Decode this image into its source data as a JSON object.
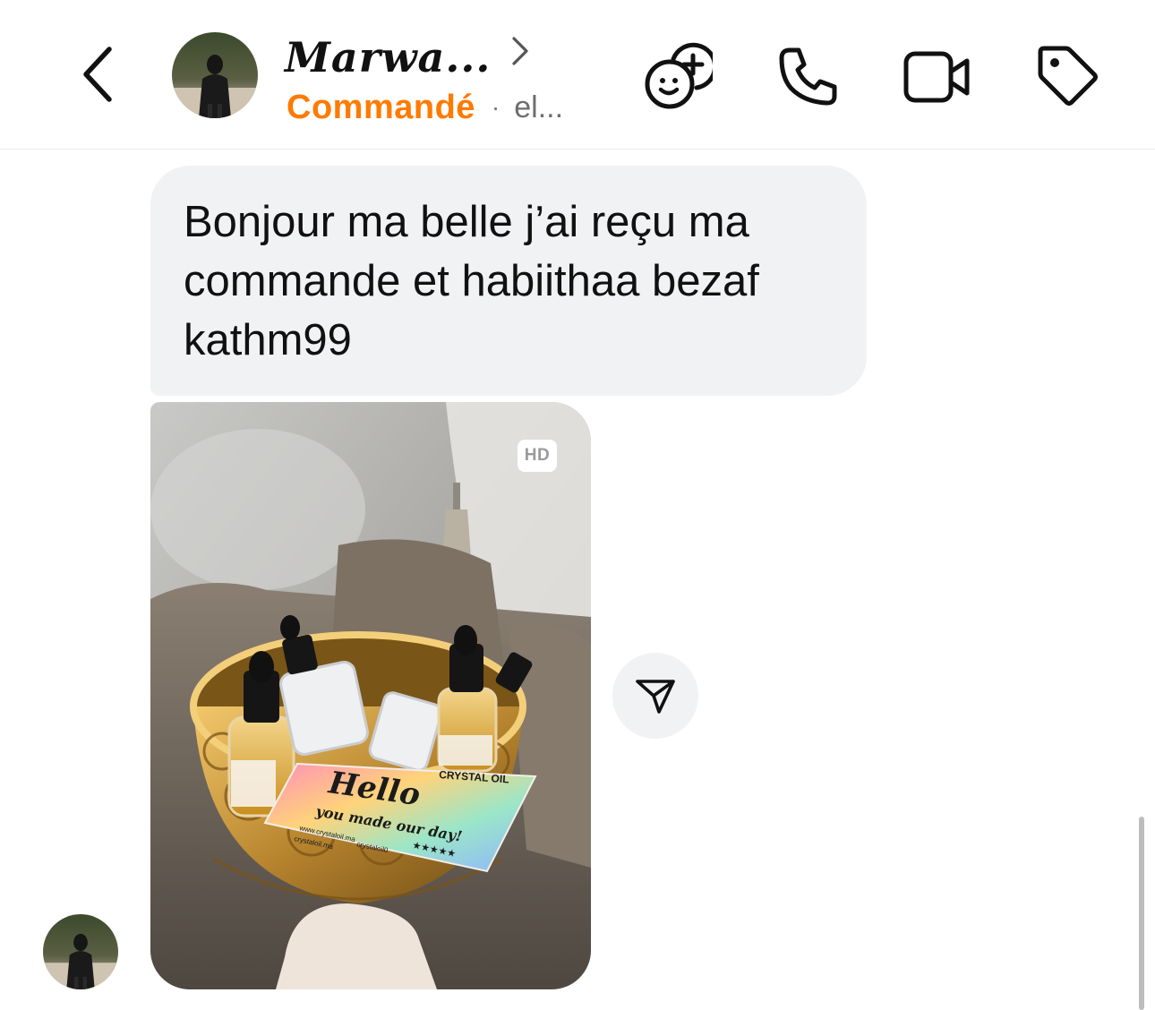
{
  "header": {
    "contact_name": "Marwa...",
    "status_label": "Commandé",
    "status_separator": "·",
    "status_extra": "el...",
    "accent_color": "#ff7a00",
    "icons": {
      "back": "chevron-left-icon",
      "profile": "chevron-right-icon",
      "effects": "face-add-icon",
      "call": "phone-icon",
      "video": "video-camera-icon",
      "tag": "tag-icon"
    }
  },
  "messages": [
    {
      "type": "text",
      "text": "Bonjour ma belle j’ai reçu ma commande et habiithaa bezaf kathm99"
    },
    {
      "type": "photo",
      "badge": "HD",
      "card_brand": "CRYSTAL OIL",
      "card_heading": "Hello",
      "card_tagline": "you made our day!",
      "card_stars": "★★★★★",
      "card_site": "www.crystaloil.ma",
      "card_handle": "crystaloil.ma",
      "card_tiktok": "crystaloil0"
    }
  ],
  "actions": {
    "share_icon": "send-icon"
  }
}
